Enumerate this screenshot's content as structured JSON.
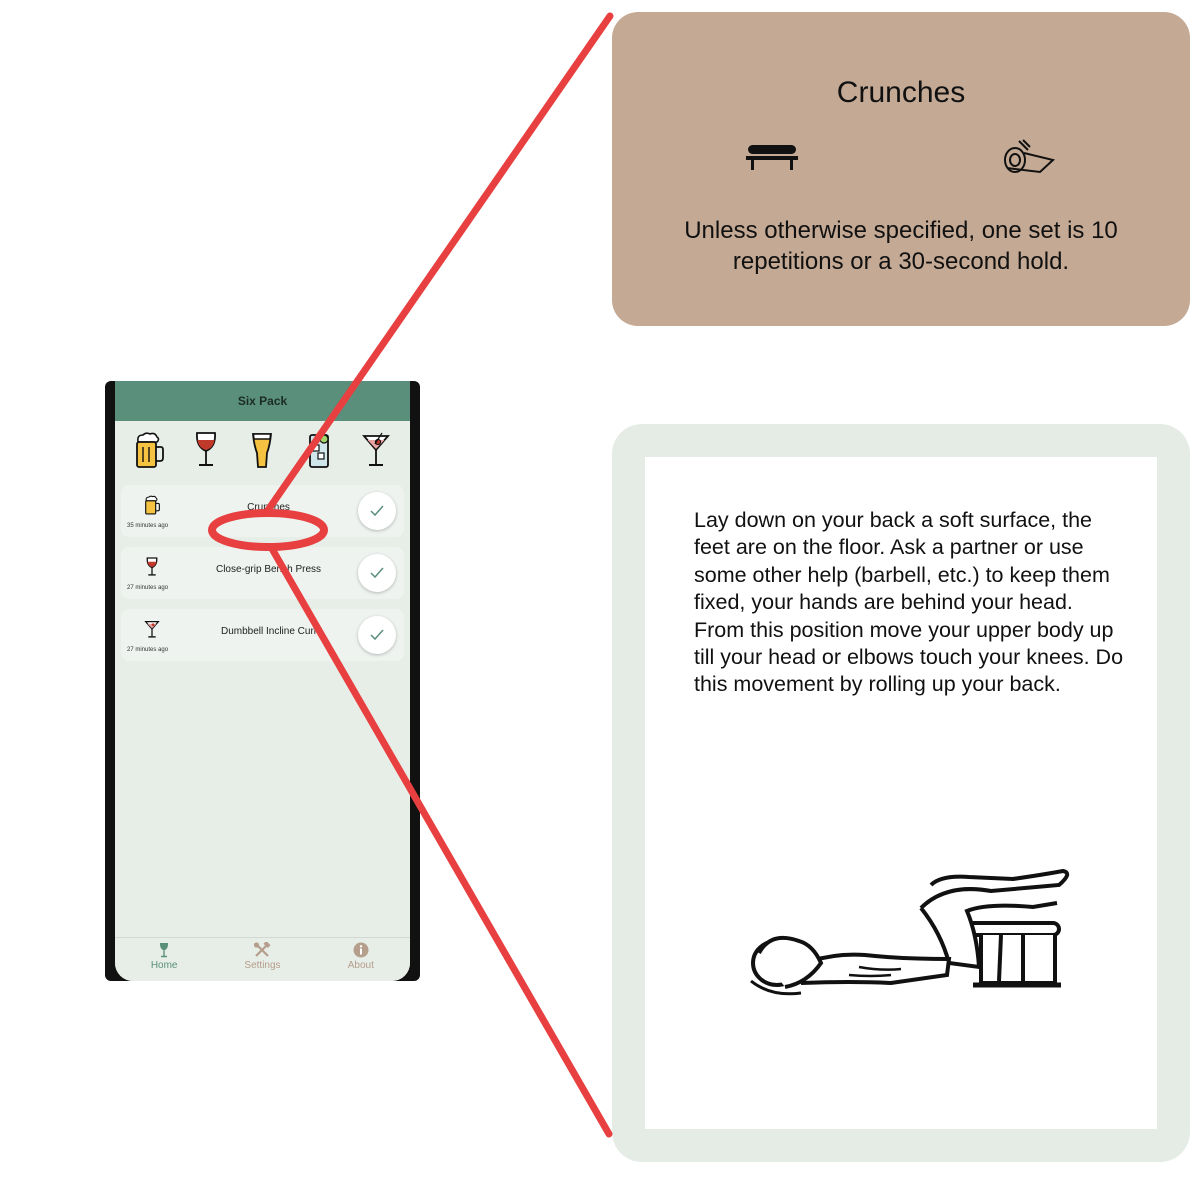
{
  "app": {
    "title": "Six Pack",
    "drinks": [
      "beer-mug",
      "red-wine",
      "wheat-beer",
      "cocktail-glass",
      "martini"
    ]
  },
  "workouts": [
    {
      "name": "Crunches",
      "time": "35 minutes ago",
      "icon": "beer-mug"
    },
    {
      "name": "Close-grip Bench Press",
      "time": "27 minutes ago",
      "icon": "red-wine"
    },
    {
      "name": "Dumbbell Incline Curl",
      "time": "27 minutes ago",
      "icon": "martini"
    }
  ],
  "tabs": [
    {
      "label": "Home",
      "icon": "wine-glass-icon",
      "active": true
    },
    {
      "label": "Settings",
      "icon": "tools-icon",
      "active": false
    },
    {
      "label": "About",
      "icon": "info-icon",
      "active": false
    }
  ],
  "exercise_card": {
    "name": "Crunches",
    "equipment_icons": [
      "bench-icon",
      "mat-icon"
    ],
    "note": "Unless otherwise specified, one set is 10 repetitions or a 30-second hold."
  },
  "description_card": {
    "text": "Lay down on your back a soft surface, the feet are on the floor. Ask a partner or use some other help (barbell, etc.) to keep them fixed, your hands are behind your head. From this position move your upper body up till your head or elbows touch your knees. Do this movement by rolling up your back.",
    "illustration": "crunch-exercise-drawing"
  },
  "colors": {
    "header": "#5a8f7b",
    "screen_bg": "#e7ede7",
    "exercise_card_bg": "#c4a994",
    "description_card_bg": "#e5ebe5",
    "annotation": "#e84040",
    "tab_active": "#5a8f7b",
    "tab_inactive": "#b59e8c"
  }
}
